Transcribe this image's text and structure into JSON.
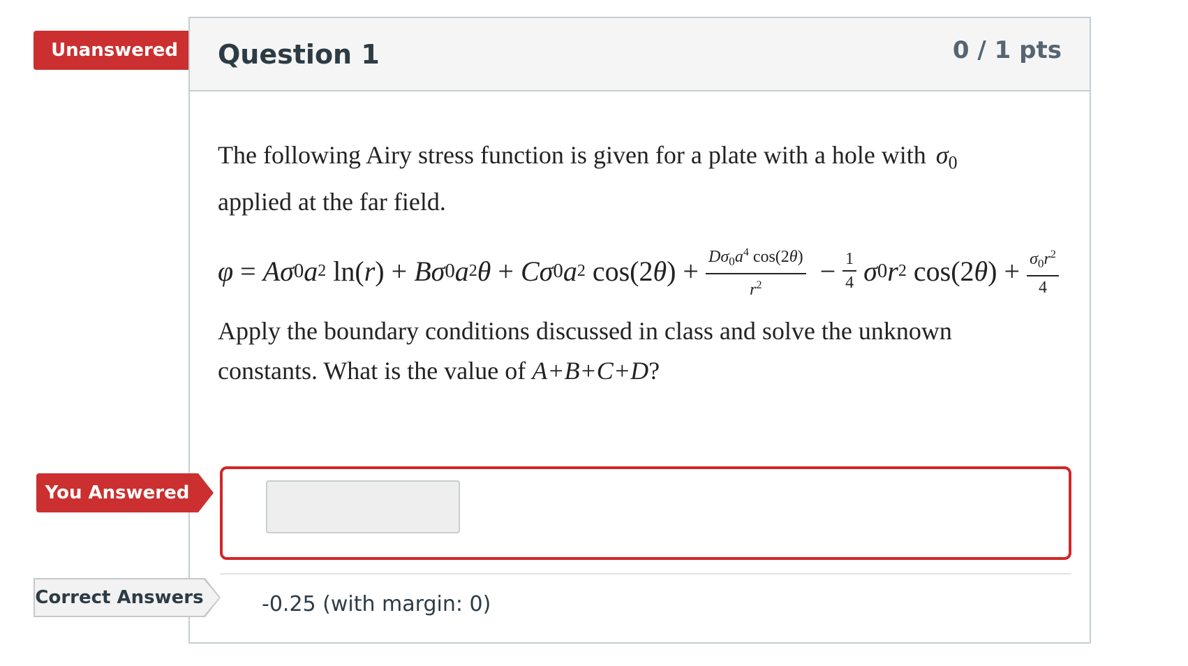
{
  "flags": {
    "unanswered": "Unanswered",
    "you_answered": "You Answered",
    "correct_answers": "Correct Answers"
  },
  "question": {
    "title": "Question 1",
    "points": "0 / 1 pts",
    "intro_line1": "The following Airy stress function is given for a plate with a hole with",
    "intro_line2": "applied at the far field.",
    "sigma_symbol": "σ",
    "sigma_sub": "0",
    "equation_text": "φ = Aσ0a² ln(r) + Bσ0a²θ + Cσ0a² cos(2θ) + Dσ0a⁴ cos(2θ)/r² − ¼σ0r² cos(2θ) + σ0r²/4",
    "instruction_line1": "Apply the boundary conditions discussed in class and solve the unknown",
    "instruction_line2_prefix": "constants.  What is the value of",
    "instruction_vars": "A+B+C+D",
    "instruction_suffix": "?"
  },
  "answer": {
    "user_value": "",
    "correct_text": "-0.25 (with margin: 0)"
  },
  "colors": {
    "flag_red": "#cc2f2f",
    "answer_border": "#d12727",
    "header_bg": "#f5f5f5"
  }
}
